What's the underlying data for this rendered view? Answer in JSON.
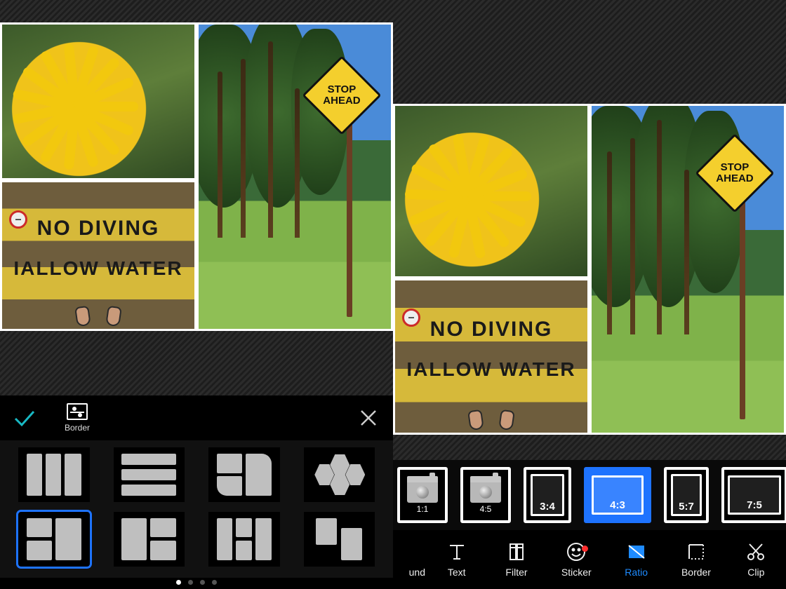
{
  "left": {
    "toolbar": {
      "confirm_icon": "check-icon",
      "cancel_icon": "close-icon",
      "border_tool_label": "Border"
    },
    "canvas": {
      "photo_sign_line1": "NO DIVING",
      "photo_sign_line2": "IALLOW WATER",
      "road_sign_line1": "STOP",
      "road_sign_line2": "AHEAD"
    },
    "layouts": {
      "selected_index": 4,
      "count": 8
    },
    "pager": {
      "total": 4,
      "active": 0
    }
  },
  "right": {
    "canvas": {
      "photo_sign_line1": "NO DIVING",
      "photo_sign_line2": "IALLOW WATER",
      "road_sign_line1": "STOP",
      "road_sign_line2": "AHEAD"
    },
    "ratio_options": [
      {
        "kind": "camera",
        "label": "1:1"
      },
      {
        "kind": "camera",
        "label": "4:5"
      },
      {
        "kind": "frame",
        "label": "3:4",
        "w": 56,
        "h": 66
      },
      {
        "kind": "frame",
        "label": "4:3",
        "w": 76,
        "h": 58,
        "selected": true
      },
      {
        "kind": "frame",
        "label": "5:7",
        "w": 52,
        "h": 66
      },
      {
        "kind": "frame",
        "label": "7:5",
        "w": 80,
        "h": 58
      }
    ],
    "tools": [
      {
        "id": "background",
        "label": "und",
        "icon": "square-icon"
      },
      {
        "id": "text",
        "label": "Text",
        "icon": "text-icon"
      },
      {
        "id": "filter",
        "label": "Filter",
        "icon": "filter-icon"
      },
      {
        "id": "sticker",
        "label": "Sticker",
        "icon": "smiley-icon",
        "badge": true
      },
      {
        "id": "ratio",
        "label": "Ratio",
        "icon": "ratio-icon",
        "active": true
      },
      {
        "id": "border",
        "label": "Border",
        "icon": "border-icon"
      },
      {
        "id": "clip",
        "label": "Clip",
        "icon": "scissors-icon"
      }
    ]
  }
}
